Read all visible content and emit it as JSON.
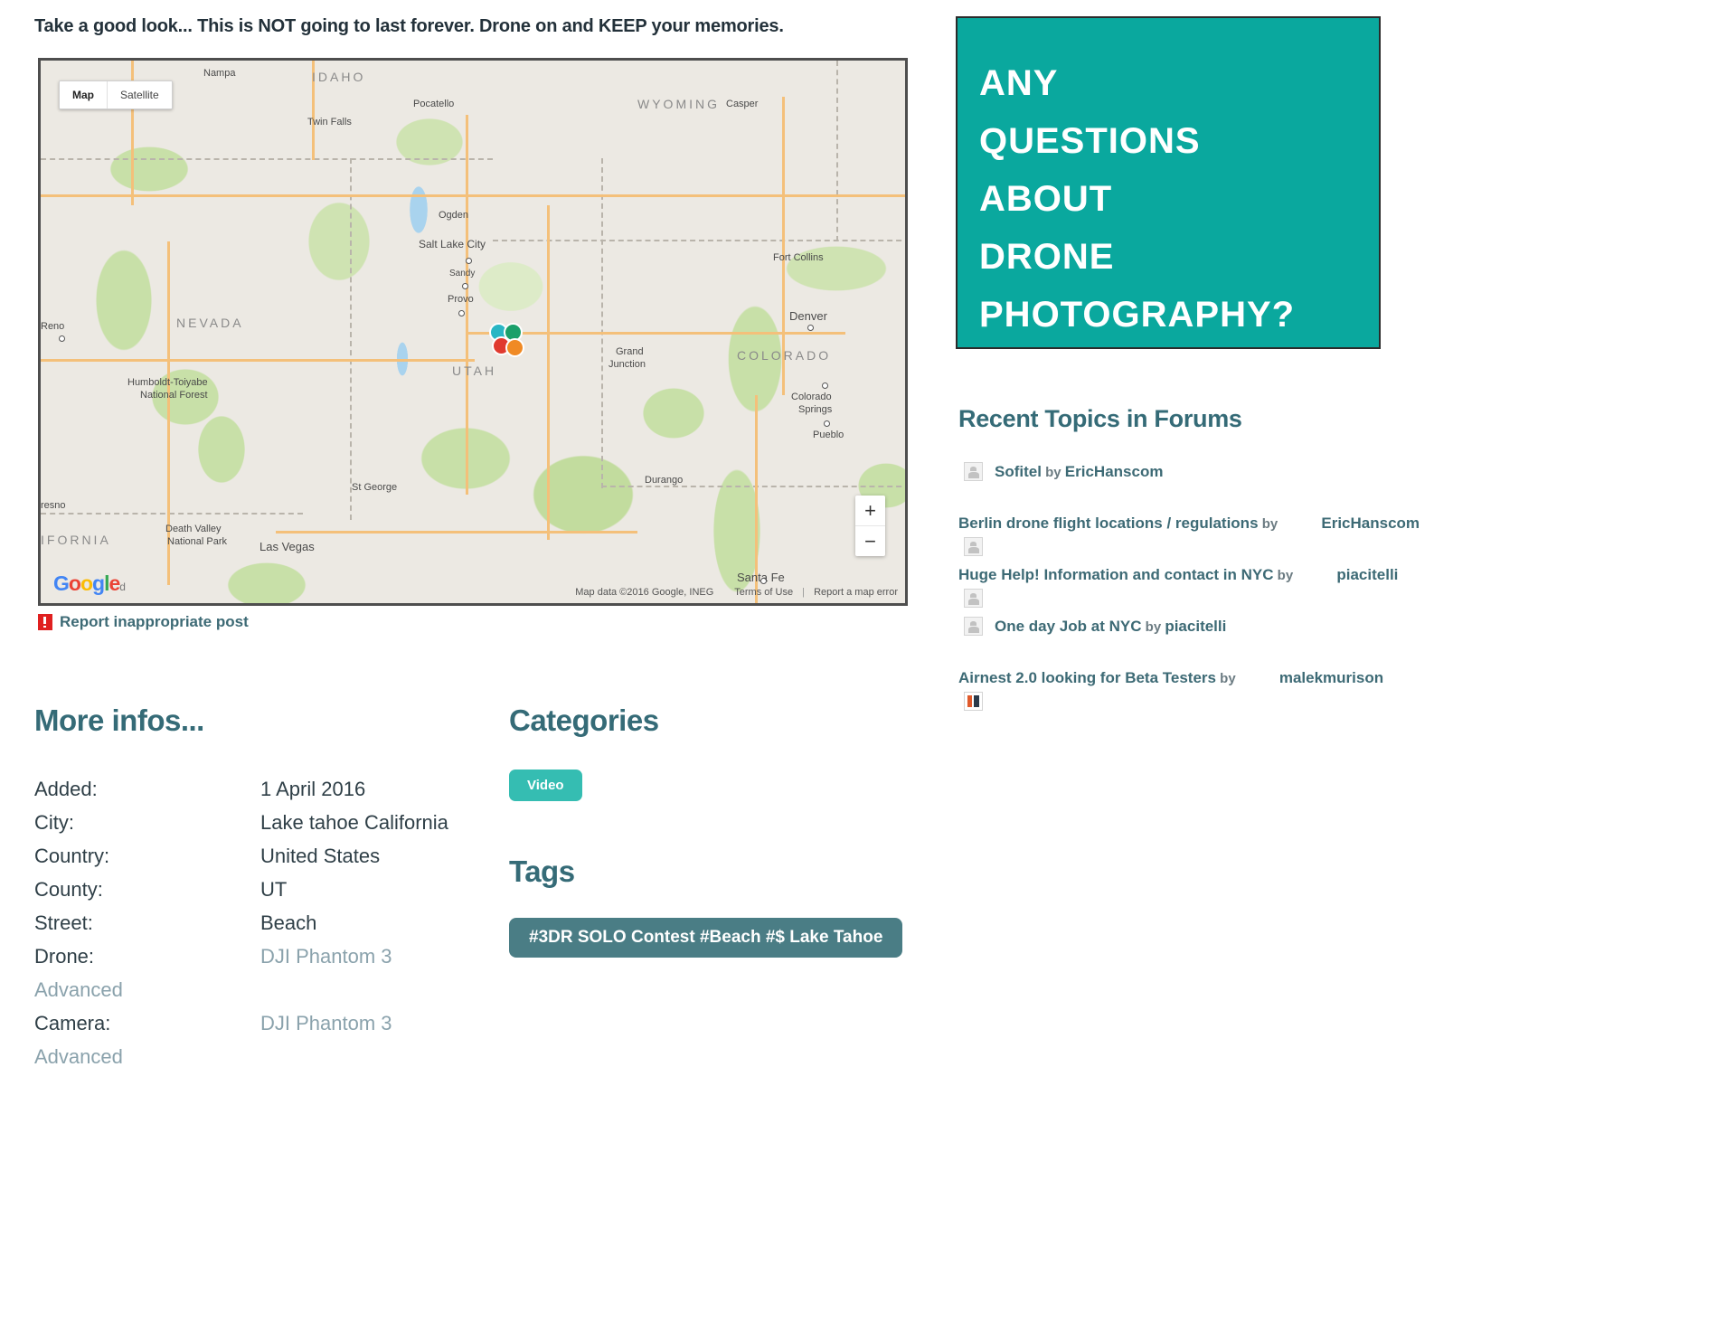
{
  "headline": "Take a good look... This is NOT going to last forever. Drone on and KEEP your memories.",
  "map": {
    "controls": {
      "map_label": "Map",
      "satellite_label": "Satellite",
      "zoom_in": "+",
      "zoom_out": "−"
    },
    "logo": {
      "g1": "G",
      "o1": "o",
      "o2": "o",
      "g2": "g",
      "l": "l",
      "e": "e",
      "tail": "d"
    },
    "attribution": {
      "map_data": "Map data ©2016 Google, INEG",
      "terms": "Terms of Use",
      "report": "Report a map error"
    },
    "labels": {
      "states": [
        "IDAHO",
        "WYOMING",
        "NEVADA",
        "UTAH",
        "COLORADO",
        "CALIFORNIA"
      ],
      "cities": [
        "Nampa",
        "Twin Falls",
        "Pocatello",
        "Casper",
        "Ogden",
        "Salt Lake City",
        "Sandy",
        "Provo",
        "Reno",
        "Fort Collins",
        "Denver",
        "Grand Junction",
        "Colorado Springs",
        "Pueblo",
        "Humboldt-Toiyabe National Forest",
        "Death Valley National Park",
        "Las Vegas",
        "St George",
        "Durango",
        "Santa Fe",
        "Fresno"
      ]
    },
    "marker_colors": [
      "#29b6c4",
      "#1aa06a",
      "#e03a2f",
      "#f08a24"
    ]
  },
  "report_post": {
    "label": "Report inappropriate post",
    "icon": "report-flag-icon"
  },
  "more_infos": {
    "title": "More infos...",
    "rows": [
      {
        "label": "Added:",
        "value": "1 April 2016",
        "is_link": false,
        "cont": ""
      },
      {
        "label": "City:",
        "value": "Lake tahoe California",
        "is_link": false,
        "cont": ""
      },
      {
        "label": "Country:",
        "value": "United States",
        "is_link": false,
        "cont": ""
      },
      {
        "label": "County:",
        "value": "UT",
        "is_link": false,
        "cont": ""
      },
      {
        "label": "Street:",
        "value": "Beach",
        "is_link": false,
        "cont": ""
      },
      {
        "label": "Drone:",
        "value": "DJI Phantom 3",
        "is_link": true,
        "cont": "Advanced"
      },
      {
        "label": "Camera:",
        "value": "DJI Phantom 3",
        "is_link": true,
        "cont": "Advanced"
      }
    ]
  },
  "categories": {
    "title": "Categories",
    "items": [
      "Video"
    ]
  },
  "tags": {
    "title": "Tags",
    "items": [
      "#3DR SOLO Contest #Beach #$ Lake Tahoe"
    ]
  },
  "banner": {
    "lines": [
      "ANY",
      "QUESTIONS",
      "ABOUT",
      "DRONE",
      "PHOTOGRAPHY?"
    ],
    "bg_color": "#0aa89e"
  },
  "forums": {
    "title": "Recent Topics in Forums",
    "by_label": "by",
    "items": [
      {
        "topic": "Sofitel",
        "author": "EricHanscom",
        "wraps": false,
        "avatar": "user-avatar-icon"
      },
      {
        "topic": "Berlin drone flight locations / regulations",
        "author": "EricHanscom",
        "wraps": true,
        "avatar": "user-avatar-icon"
      },
      {
        "topic": "Huge Help! Information and contact in NYC",
        "author": "piacitelli",
        "wraps": true,
        "avatar": "user-avatar-icon"
      },
      {
        "topic": "One day Job at NYC",
        "author": "piacitelli",
        "wraps": false,
        "avatar": "user-avatar-icon"
      },
      {
        "topic": "Airnest 2.0 looking for Beta Testers",
        "author": "malekmurison",
        "wraps": true,
        "avatar": "user-avatar-color-icon"
      }
    ]
  },
  "colors": {
    "accent_teal": "#0aa89e",
    "heading": "#356b77",
    "link": "#3d6a75",
    "tag_bg": "#4a7d85",
    "category_bg": "#35bdb2"
  }
}
